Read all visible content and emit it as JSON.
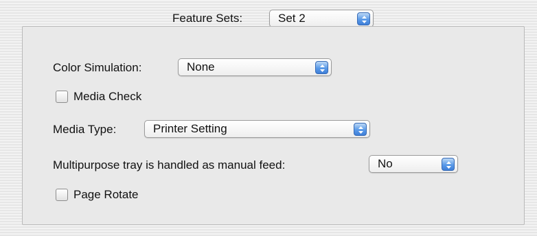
{
  "feature_sets": {
    "label": "Feature Sets:",
    "value": "Set 2"
  },
  "color_simulation": {
    "label": "Color Simulation:",
    "value": "None"
  },
  "media_check": {
    "label": "Media Check",
    "checked": false
  },
  "media_type": {
    "label": "Media Type:",
    "value": "Printer Setting"
  },
  "multipurpose_tray": {
    "label": "Multipurpose tray is handled as manual feed:",
    "value": "No"
  },
  "page_rotate": {
    "label": "Page Rotate",
    "checked": false
  },
  "colors": {
    "stepper_blue": "#5a9ae8",
    "panel_background": "#e9e9e9"
  }
}
